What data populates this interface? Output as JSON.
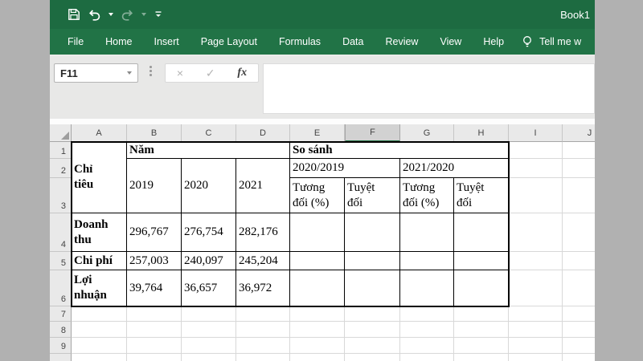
{
  "window": {
    "title": "Book1"
  },
  "colors": {
    "titlebar_green": "#1d6b41",
    "ribbon_green": "#217346",
    "selected_header_bg": "#d2d2d2",
    "selected_header_underline": "#217346",
    "gridline": "#d8d8d8",
    "table_border": "#000000",
    "formula_area_bg": "#e8e8e7",
    "desktop_bg": "#b1b1b1"
  },
  "qat": {
    "icons": [
      "save-icon",
      "undo-icon",
      "redo-icon",
      "customize-quick-access-icon"
    ]
  },
  "ribbon": {
    "tabs": [
      "File",
      "Home",
      "Insert",
      "Page Layout",
      "Formulas",
      "Data",
      "Review",
      "View",
      "Help"
    ],
    "search_icon": "lightbulb-icon",
    "search_label": "Tell me w"
  },
  "formula_bar": {
    "name_box_value": "F11",
    "cancel_icon": "×",
    "enter_icon": "✓",
    "function_icon": "fx",
    "formula_value": ""
  },
  "grid": {
    "columns": [
      "A",
      "B",
      "C",
      "D",
      "E",
      "F",
      "G",
      "H",
      "I",
      "J"
    ],
    "selected_column": "F",
    "selected_cell": "F11",
    "rows": [
      "1",
      "2",
      "3",
      "4",
      "5",
      "6",
      "7",
      "8",
      "9",
      ""
    ]
  },
  "cells": {
    "A1": "Chỉ tiêu",
    "B1": "Năm",
    "E1": "So sánh",
    "B2": "2019",
    "C2": "2020",
    "D2": "2021",
    "E2": "2020/2019",
    "G2": "2021/2020",
    "E3": "Tương đối (%)",
    "F3": "Tuyệt đối",
    "G3": "Tương đối (%)",
    "H3": "Tuyệt đối",
    "A4": "Doanh thu",
    "B4": "296,767",
    "C4": "276,754",
    "D4": "282,176",
    "A5": "Chi phí",
    "B5": "257,003",
    "C5": "240,097",
    "D5": "245,204",
    "A6": "Lợi nhuận",
    "B6": "39,764",
    "C6": "36,657",
    "D6": "36,972"
  }
}
